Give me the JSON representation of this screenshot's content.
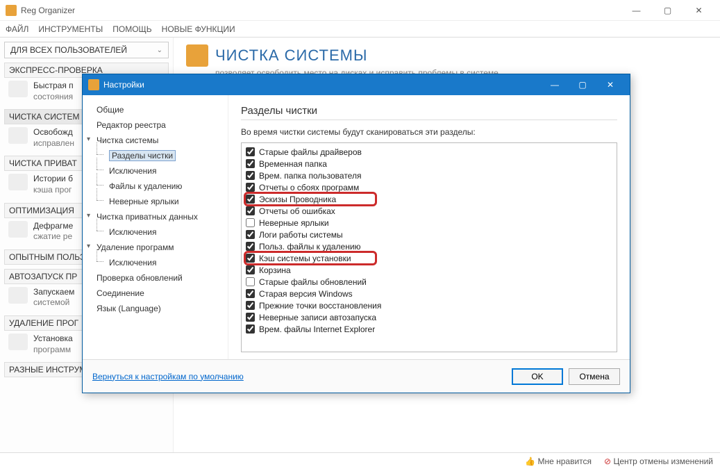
{
  "window": {
    "title": "Reg Organizer",
    "menu": [
      "ФАЙЛ",
      "ИНСТРУМЕНТЫ",
      "ПОМОЩЬ",
      "НОВЫЕ ФУНКЦИИ"
    ],
    "user_selector": "ДЛЯ ВСЕХ ПОЛЬЗОВАТЕЛЕЙ"
  },
  "sidebar": {
    "groups": [
      {
        "header": "ЭКСПРЕСС-ПРОВЕРКА",
        "item_title": "Быстрая п",
        "item_sub": "состояния"
      },
      {
        "header": "ЧИСТКА СИСТЕМ",
        "item_title": "Освобожд",
        "item_sub": "исправлен",
        "active": true
      },
      {
        "header": "ЧИСТКА ПРИВАТ",
        "item_title": "Истории б",
        "item_sub": "кэша прог"
      },
      {
        "header": "ОПТИМИЗАЦИЯ",
        "item_title": "Дефрагме",
        "item_sub": "сжатие ре"
      },
      {
        "header": "ОПЫТНЫМ ПОЛЬЗ",
        "standalone": true
      },
      {
        "header": "АВТОЗАПУСК ПР",
        "item_title": "Запускаем",
        "item_sub": "системой"
      },
      {
        "header": "УДАЛЕНИЕ ПРОГ",
        "item_title": "Установка",
        "item_sub": "программ"
      },
      {
        "header": "РАЗНЫЕ ИНСТРУМ",
        "standalone": true
      }
    ]
  },
  "page": {
    "title": "ЧИСТКА СИСТЕМЫ",
    "subtitle": "позволяет освободить место на дисках и исправить проблемы в системе."
  },
  "statusbar": {
    "like": "Мне нравится",
    "undo": "Центр отмены изменений"
  },
  "dialog": {
    "title": "Настройки",
    "tree": [
      {
        "label": "Общие",
        "level": 0
      },
      {
        "label": "Редактор реестра",
        "level": 0
      },
      {
        "label": "Чистка системы",
        "level": 0,
        "expandable": true
      },
      {
        "label": "Разделы чистки",
        "level": 1,
        "selected": true
      },
      {
        "label": "Исключения",
        "level": 1
      },
      {
        "label": "Файлы к удалению",
        "level": 1
      },
      {
        "label": "Неверные ярлыки",
        "level": 1
      },
      {
        "label": "Чистка приватных данных",
        "level": 0,
        "expandable": true
      },
      {
        "label": "Исключения",
        "level": 1
      },
      {
        "label": "Удаление программ",
        "level": 0,
        "expandable": true
      },
      {
        "label": "Исключения",
        "level": 1
      },
      {
        "label": "Проверка обновлений",
        "level": 0
      },
      {
        "label": "Соединение",
        "level": 0
      },
      {
        "label": "Язык (Language)",
        "level": 0
      }
    ],
    "content": {
      "heading": "Разделы чистки",
      "description": "Во время чистки системы будут сканироваться эти разделы:",
      "items": [
        {
          "label": "Старые файлы драйверов",
          "checked": true
        },
        {
          "label": "Временная папка",
          "checked": true
        },
        {
          "label": "Врем. папка пользователя",
          "checked": true
        },
        {
          "label": "Отчеты о сбоях программ",
          "checked": true
        },
        {
          "label": "Эскизы Проводника",
          "checked": true,
          "highlight": 1
        },
        {
          "label": "Отчеты об ошибках",
          "checked": true
        },
        {
          "label": "Неверные ярлыки",
          "checked": false
        },
        {
          "label": "Логи работы системы",
          "checked": true
        },
        {
          "label": "Польз. файлы к удалению",
          "checked": true
        },
        {
          "label": "Кэш системы установки",
          "checked": true,
          "highlight": 2
        },
        {
          "label": "Корзина",
          "checked": true
        },
        {
          "label": "Старые файлы обновлений",
          "checked": false
        },
        {
          "label": "Старая версия Windows",
          "checked": true
        },
        {
          "label": "Прежние точки восстановления",
          "checked": true
        },
        {
          "label": "Неверные записи автозапуска",
          "checked": true
        },
        {
          "label": "Врем. файлы Internet Explorer",
          "checked": true
        }
      ]
    },
    "footer": {
      "reset_link": "Вернуться к настройкам по умолчанию",
      "ok": "OK",
      "cancel": "Отмена"
    }
  }
}
